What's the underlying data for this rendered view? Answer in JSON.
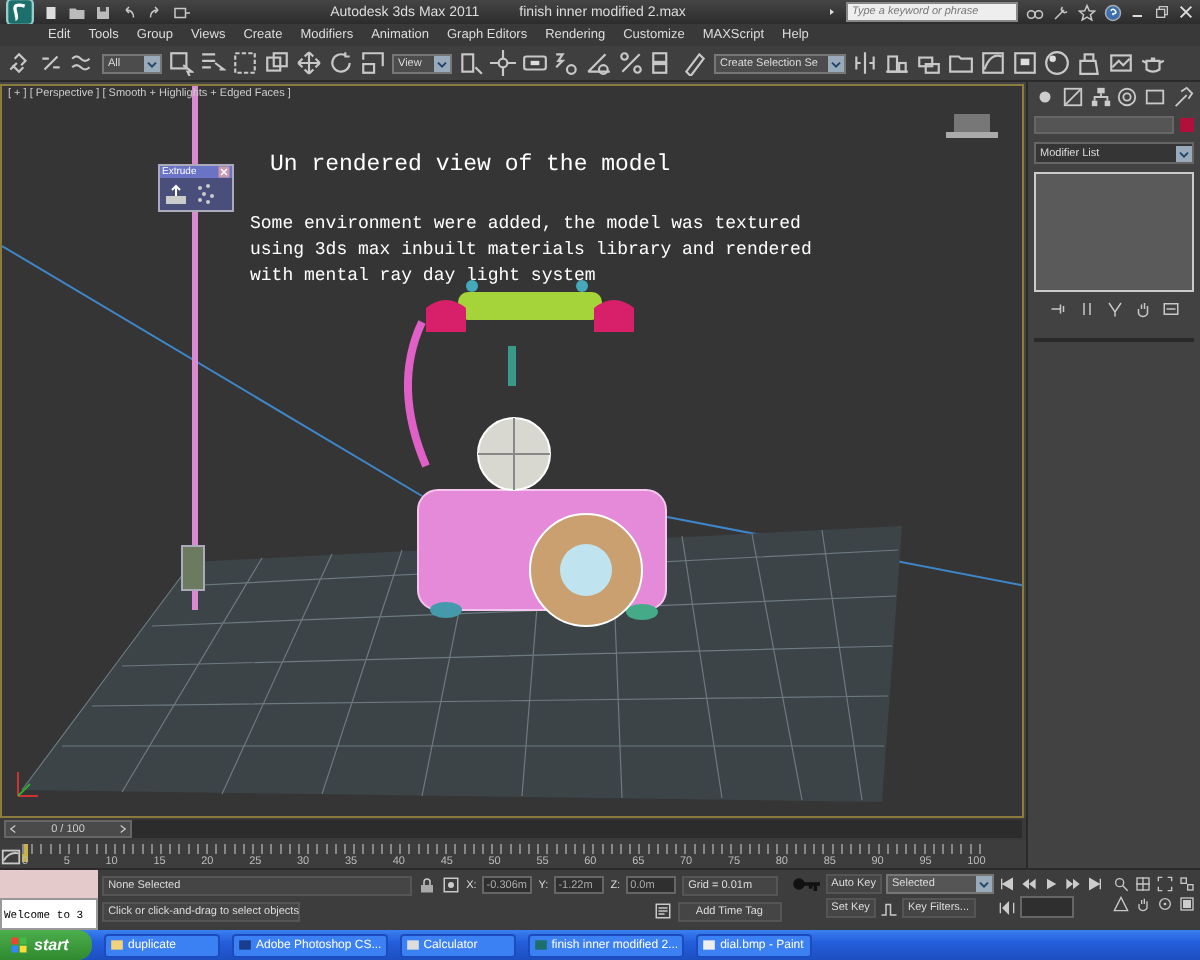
{
  "title_bar": {
    "app": "Autodesk 3ds Max  2011",
    "file": "finish inner modified 2.max",
    "search": {
      "placeholder": "Type a keyword or phrase"
    }
  },
  "menu": [
    "Edit",
    "Tools",
    "Group",
    "Views",
    "Create",
    "Modifiers",
    "Animation",
    "Graph Editors",
    "Rendering",
    "Customize",
    "MAXScript",
    "Help"
  ],
  "toolbar": {
    "selection_filter": "All",
    "reference_coordinate": "View",
    "named_selection": "Create Selection Se"
  },
  "viewport": {
    "label": "[ + ] [ Perspective ] [ Smooth + Highlights + Edged Faces ]",
    "heading": "Un rendered view of the model",
    "caption": "Some environment were added, the model was textured using 3ds max inbuilt materials library and rendered with mental ray day light system",
    "floating_toolbar": {
      "title": "Extrude"
    }
  },
  "command_panel": {
    "modifier_list": "Modifier List"
  },
  "time_slider": {
    "position": "0 / 100"
  },
  "ruler": {
    "labels": [
      "0",
      "5",
      "10",
      "15",
      "20",
      "25",
      "30",
      "35",
      "40",
      "45",
      "50",
      "55",
      "60",
      "65",
      "70",
      "75",
      "80",
      "85",
      "90",
      "95",
      "100"
    ]
  },
  "status": {
    "listener": "Welcome to 3",
    "selection": "None Selected",
    "prompt": "Click or click-and-drag to select objects",
    "coordinates": [
      {
        "axis": "X:",
        "value": "-0.306m"
      },
      {
        "axis": "Y:",
        "value": "-1.22m"
      },
      {
        "axis": "Z:",
        "value": "0.0m"
      }
    ],
    "grid": "Grid = 0.01m",
    "time_tag": "Add Time Tag",
    "auto_key": "Auto Key",
    "key_mode": "Selected",
    "set_key": "Set Key",
    "key_filters": "Key Filters..."
  },
  "taskbar": {
    "start": "start",
    "buttons": [
      "duplicate",
      "Adobe Photoshop CS...",
      "Calculator",
      "finish inner modified 2...",
      "dial.bmp - Paint"
    ]
  }
}
